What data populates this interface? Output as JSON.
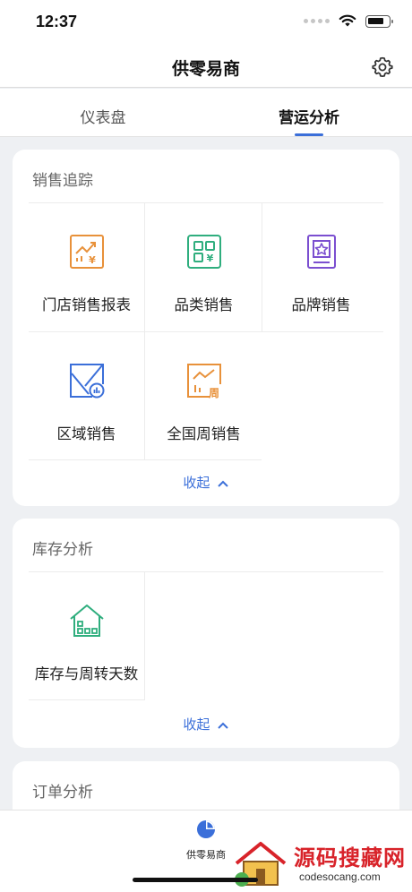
{
  "status_bar": {
    "time": "12:37"
  },
  "nav": {
    "title": "供零易商",
    "settings_icon": "gear-icon"
  },
  "tabs": [
    {
      "label": "仪表盘",
      "active": false
    },
    {
      "label": "营运分析",
      "active": true
    }
  ],
  "sales_tracking": {
    "title": "销售追踪",
    "items": [
      {
        "label": "门店销售报表",
        "icon": "store-sales-report-icon",
        "color": "#e8913a"
      },
      {
        "label": "品类销售",
        "icon": "category-sales-icon",
        "color": "#2fae7e"
      },
      {
        "label": "品牌销售",
        "icon": "brand-sales-icon",
        "color": "#7b4fd0"
      },
      {
        "label": "区域销售",
        "icon": "region-sales-icon",
        "color": "#3b6fd9"
      },
      {
        "label": "全国周销售",
        "icon": "national-weekly-sales-icon",
        "color": "#e8913a"
      }
    ],
    "collapse_label": "收起"
  },
  "inventory": {
    "title": "库存分析",
    "items": [
      {
        "label": "库存与周转天数",
        "icon": "inventory-turnover-icon",
        "color": "#2fae7e"
      }
    ],
    "collapse_label": "收起"
  },
  "orders": {
    "title": "订单分析"
  },
  "bottom_nav": {
    "label": "供零易商",
    "icon": "pie-chart-icon",
    "color": "#3b6fd9"
  },
  "watermark": {
    "text": "源码搜藏网",
    "sub": "codesocang.com"
  }
}
